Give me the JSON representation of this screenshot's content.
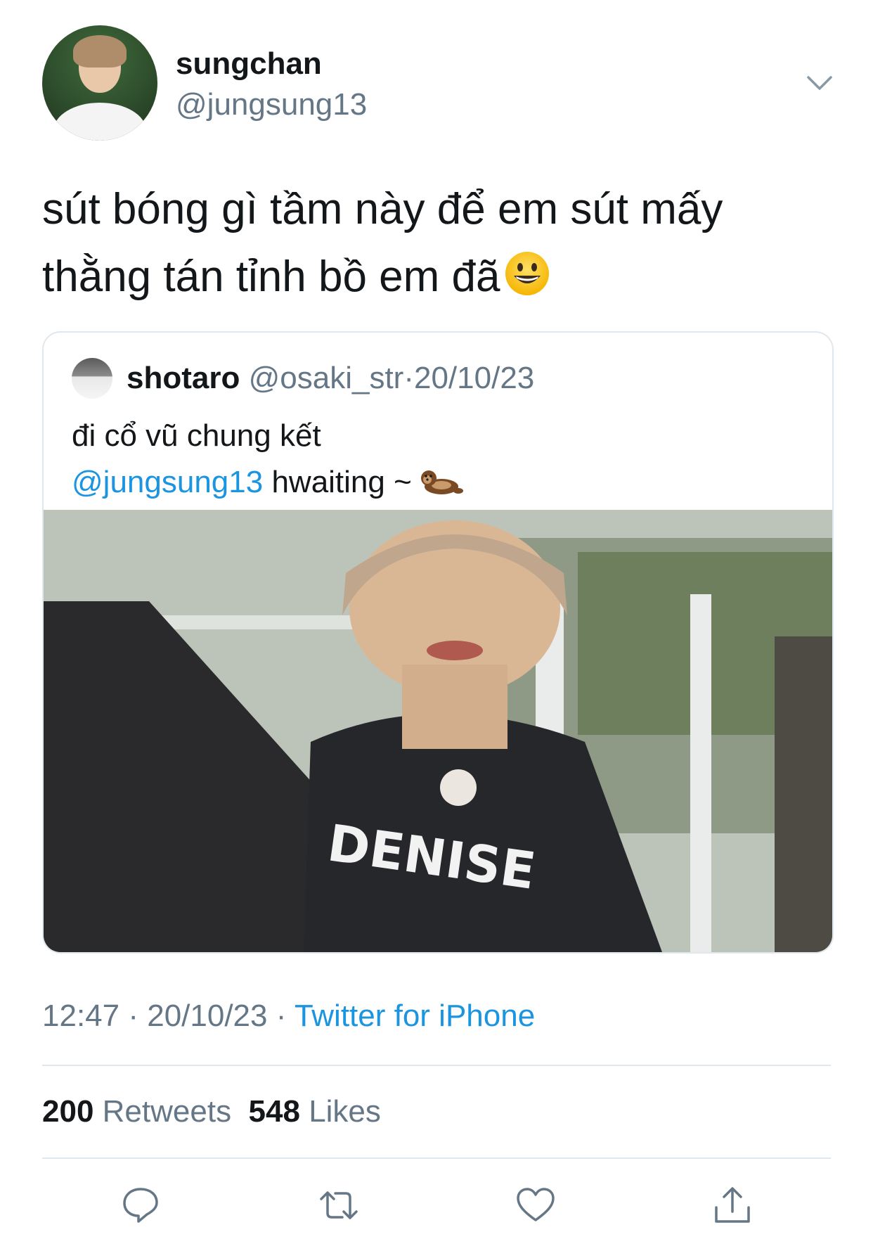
{
  "author": {
    "name": "sungchan",
    "handle": "@jungsung13"
  },
  "tweet": {
    "text_line1": "sút bóng gì tầm này để em sút mấy",
    "text_line2": "thằng tán tỉnh bồ em đã",
    "emoji": "smiling-face-emoji"
  },
  "quote": {
    "name": "shotaro",
    "handle": "@osaki_str",
    "separator": "·",
    "date": "20/10/23",
    "text_line1": "đi cổ vũ chung kết",
    "mention": "@jungsung13",
    "text_after_mention": " hwaiting ~ ",
    "emoji": "otter-emoji"
  },
  "meta": {
    "time": "12:47",
    "sep1": " · ",
    "date": "20/10/23",
    "sep2": " · ",
    "source": "Twitter for iPhone"
  },
  "stats": {
    "retweets_count": "200",
    "retweets_label": "Retweets",
    "likes_count": "548",
    "likes_label": "Likes"
  },
  "colors": {
    "text": "#14171a",
    "secondary": "#657786",
    "link": "#1b95e0",
    "border": "#e1e8ed"
  }
}
